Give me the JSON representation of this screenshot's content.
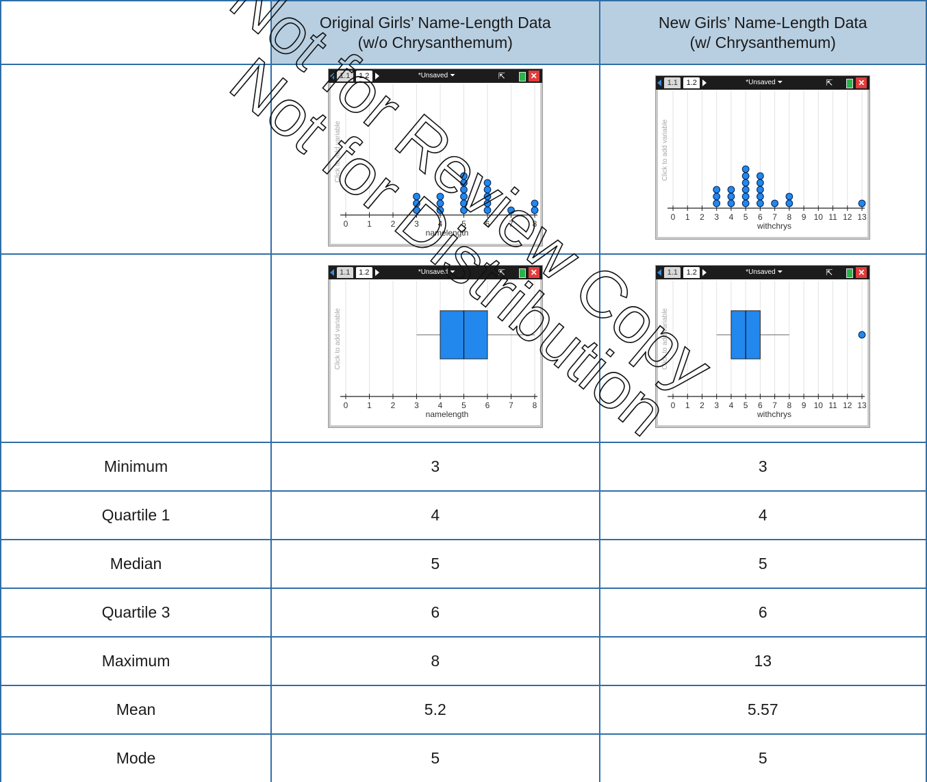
{
  "headers": {
    "col1": [
      "Original Girls’ Name-Length Data",
      "(w/o Chrysanthemum)"
    ],
    "col2": [
      "New Girls’ Name-Length Data",
      "(w/ Chrysanthemum)"
    ]
  },
  "calculator": {
    "tab1": "1.1",
    "tab2": "1.2",
    "doc_name": "*Unsaved",
    "side_label": "Click to add variable",
    "close_glyph": "✕",
    "pointer_glyph": "⇱"
  },
  "plots": {
    "dot_original": {
      "type": "dot",
      "xlabel": "namelength",
      "ticks": [
        0,
        1,
        2,
        3,
        4,
        5,
        6,
        7,
        8
      ],
      "xlim": [
        0,
        8
      ],
      "counts": [
        {
          "x": 3,
          "n": 3
        },
        {
          "x": 4,
          "n": 3
        },
        {
          "x": 5,
          "n": 6
        },
        {
          "x": 6,
          "n": 5
        },
        {
          "x": 7,
          "n": 1
        },
        {
          "x": 8,
          "n": 2
        }
      ]
    },
    "dot_new": {
      "type": "dot",
      "xlabel": "withchrys",
      "ticks": [
        0,
        1,
        2,
        3,
        4,
        5,
        6,
        7,
        8,
        9,
        10,
        11,
        12,
        13
      ],
      "xlim": [
        0,
        13
      ],
      "counts": [
        {
          "x": 3,
          "n": 3
        },
        {
          "x": 4,
          "n": 3
        },
        {
          "x": 5,
          "n": 6
        },
        {
          "x": 6,
          "n": 5
        },
        {
          "x": 7,
          "n": 1
        },
        {
          "x": 8,
          "n": 2
        },
        {
          "x": 13,
          "n": 1
        }
      ]
    },
    "box_original": {
      "type": "box",
      "xlabel": "namelength",
      "ticks": [
        0,
        1,
        2,
        3,
        4,
        5,
        6,
        7,
        8
      ],
      "xlim": [
        0,
        8
      ],
      "min": 3,
      "q1": 4,
      "median": 5,
      "q3": 6,
      "max": 8,
      "outliers": []
    },
    "box_new": {
      "type": "box",
      "xlabel": "withchrys",
      "ticks": [
        0,
        1,
        2,
        3,
        4,
        5,
        6,
        7,
        8,
        9,
        10,
        11,
        12,
        13
      ],
      "xlim": [
        0,
        13
      ],
      "min": 3,
      "q1": 4,
      "median": 5,
      "q3": 6,
      "whisker_max": 8,
      "outliers": [
        13
      ]
    }
  },
  "rows": [
    {
      "label": "Minimum",
      "original": "3",
      "new": "3"
    },
    {
      "label": "Quartile 1",
      "original": "4",
      "new": "4"
    },
    {
      "label": "Median",
      "original": "5",
      "new": "5"
    },
    {
      "label": "Quartile 3",
      "original": "6",
      "new": "6"
    },
    {
      "label": "Maximum",
      "original": "8",
      "new": "13"
    },
    {
      "label": "Mean",
      "original": "5.2",
      "new": "5.57"
    },
    {
      "label": "Mode",
      "original": "5",
      "new": "5"
    }
  ],
  "watermark": [
    "Not for Review Copy",
    "Not for Distribution"
  ],
  "colors": {
    "header_fill": "#b8cfe1",
    "border": "#2f6ea6",
    "plot_blue": "#2288ee"
  }
}
